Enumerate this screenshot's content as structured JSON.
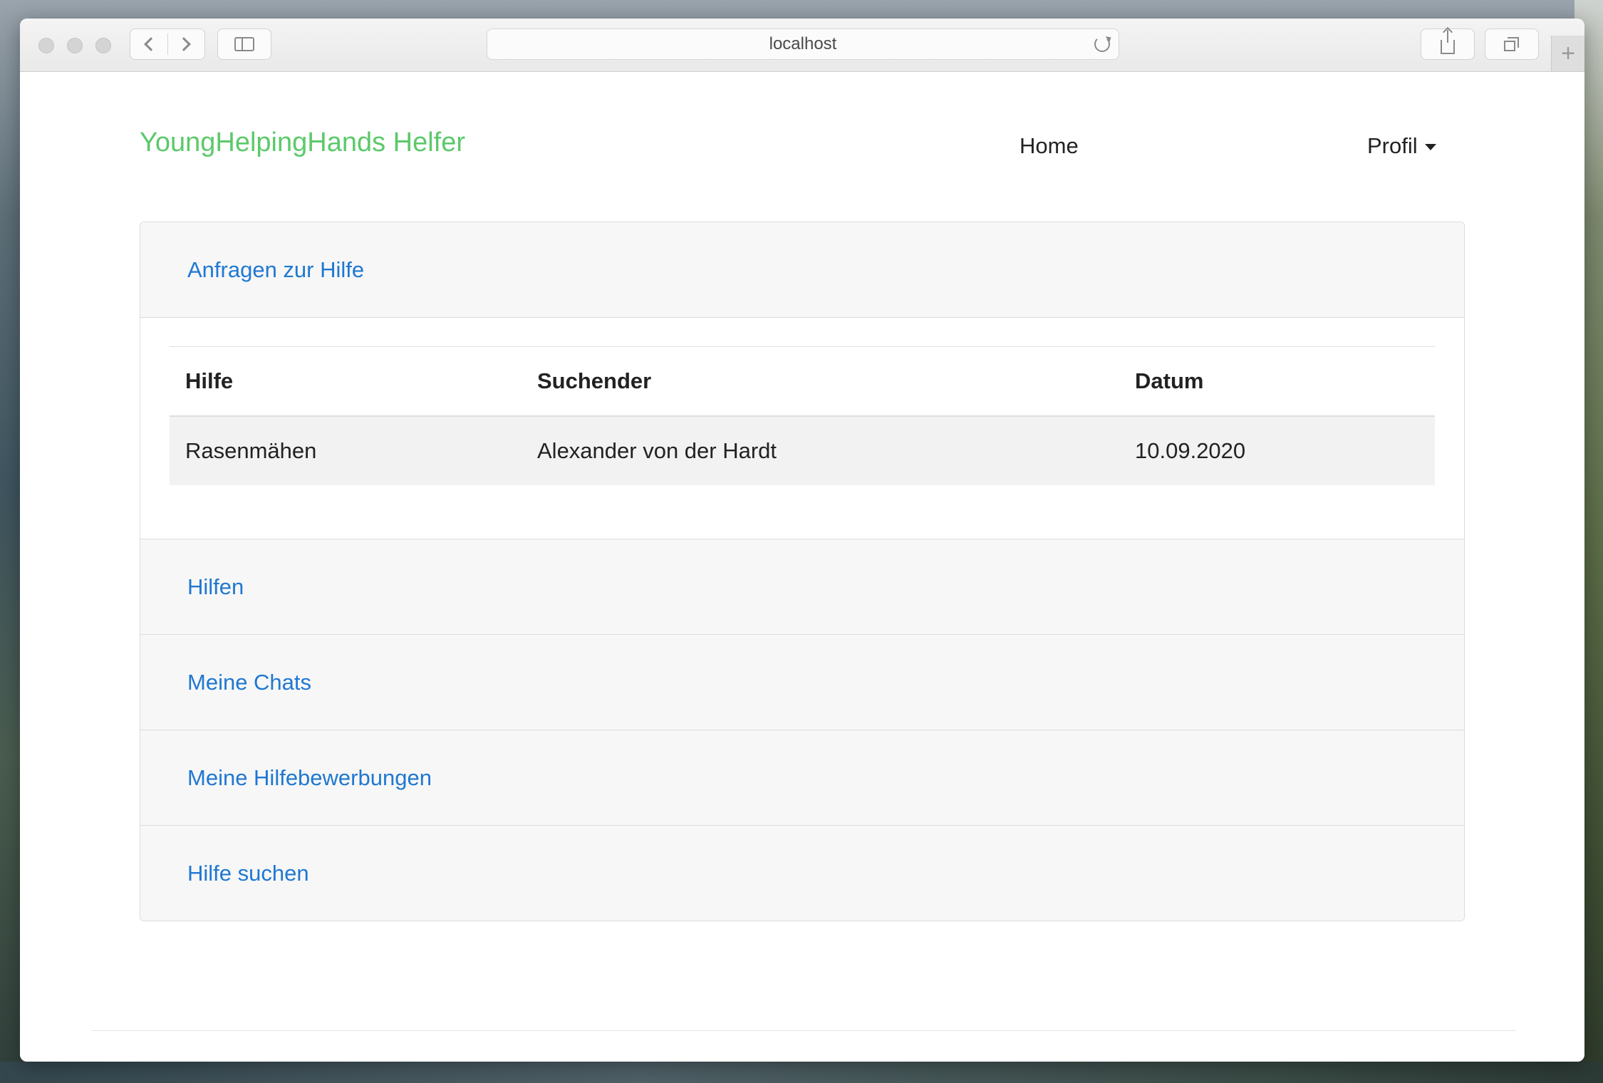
{
  "browser": {
    "address": "localhost"
  },
  "navbar": {
    "brand": "YoungHelpingHands Helfer",
    "home": "Home",
    "profile": "Profil"
  },
  "sections": [
    {
      "label": "Anfragen zur Hilfe"
    },
    {
      "label": "Hilfen"
    },
    {
      "label": "Meine Chats"
    },
    {
      "label": "Meine Hilfebewerbungen"
    },
    {
      "label": "Hilfe suchen"
    }
  ],
  "requests_table": {
    "headers": [
      "Hilfe",
      "Suchender",
      "Datum"
    ],
    "rows": [
      [
        "Rasenmähen",
        "Alexander von der Hardt",
        "10.09.2020"
      ]
    ]
  },
  "colors": {
    "brand": "#5cc96a",
    "link": "#1f78d1"
  }
}
